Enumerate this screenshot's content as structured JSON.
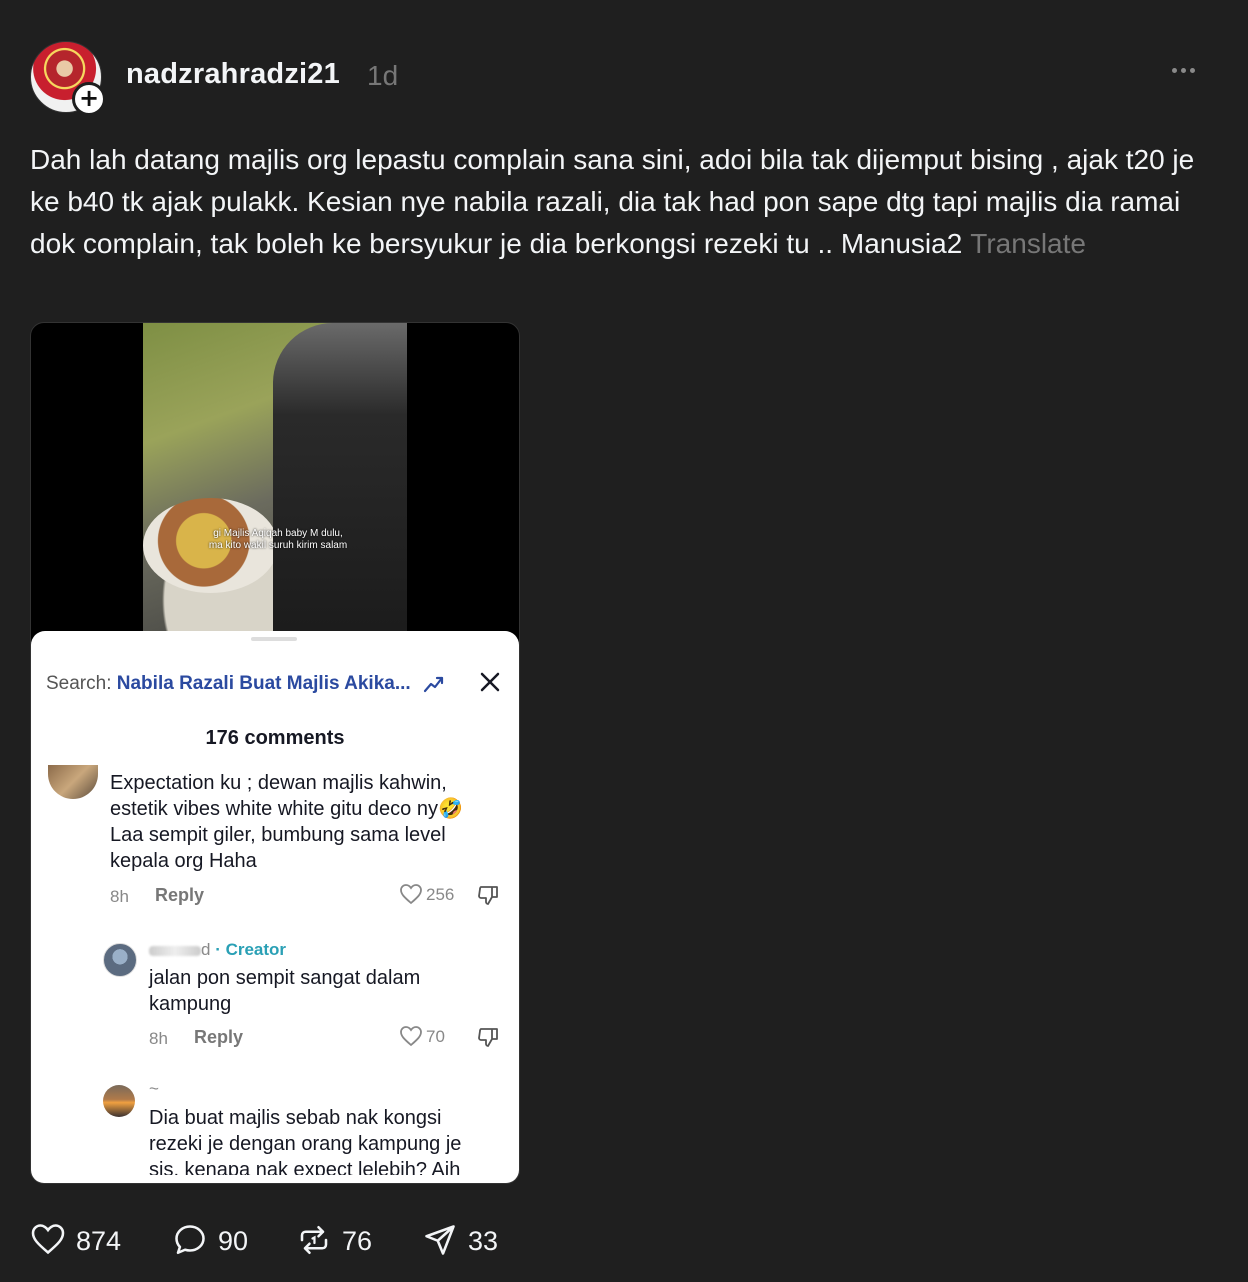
{
  "post": {
    "username": "nadzrahradzi21",
    "time_ago": "1d",
    "body_text": "Dah lah datang majlis org lepastu complain sana sini, adoi bila tak dijemput bising , ajak t20 je ke b40 tk ajak pulakk. Kesian nye nabila razali, dia tak had pon sape dtg tapi majlis dia ramai dok complain, tak boleh ke bersyukur je dia berkongsi rezeki tu .. Manusia2",
    "translate_label": "Translate"
  },
  "media": {
    "video_caption_line1": "gi Majlis Aqiqah baby M dulu,",
    "video_caption_line2": "ma kito wakil suruh kirim salam",
    "sheet": {
      "search_prefix": "Search:",
      "search_query": "Nabila Razali Buat Majlis Akika...",
      "comments_count": "176 comments",
      "comments": [
        {
          "text_line1": "Expectation ku ; dewan majlis kahwin,",
          "text_line2": "estetik vibes white white gitu deco ny🤣",
          "text_line3": "Laa sempit giler, bumbung sama level",
          "text_line4": "kepala org Haha",
          "time": "8h",
          "reply_label": "Reply",
          "likes": "256"
        },
        {
          "author_suffix": "d",
          "creator_label": "· Creator",
          "text_line1": "jalan pon sempit sangat dalam",
          "text_line2": "kampung",
          "time": "8h",
          "reply_label": "Reply",
          "likes": "70"
        },
        {
          "author": "~",
          "text_line1": "Dia buat majlis sebab nak kongsi",
          "text_line2": "rezeki je dengan orang kampung je",
          "text_line3": "sis, kenapa nak expect lelebih? Aih"
        }
      ]
    }
  },
  "actions": {
    "likes": "874",
    "comments": "90",
    "reposts": "76",
    "shares": "33"
  }
}
